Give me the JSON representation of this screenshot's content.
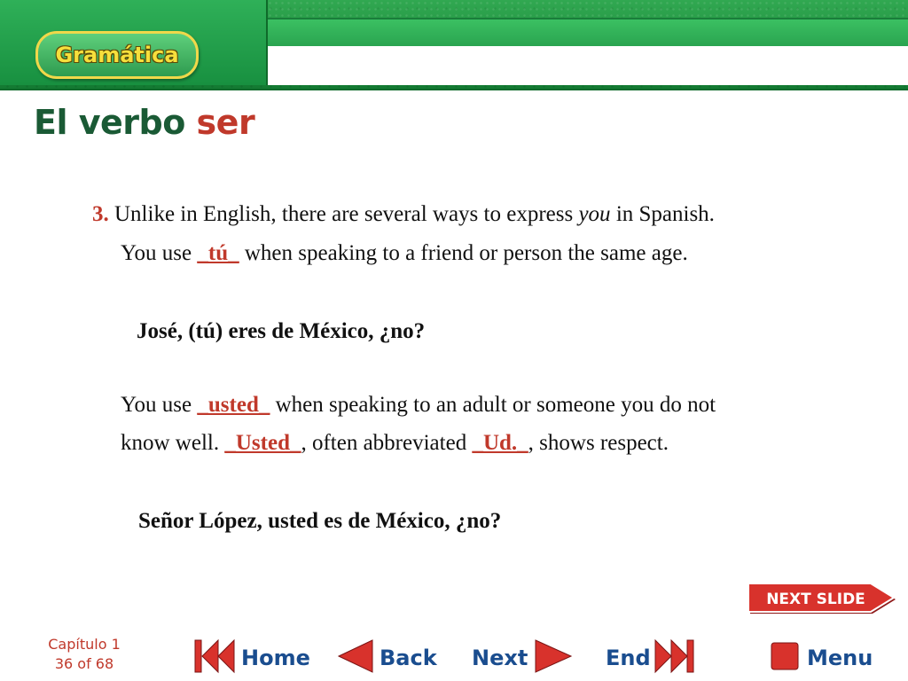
{
  "header": {
    "section_label": "Gramática"
  },
  "title": {
    "part1": "El verbo",
    "part2": "ser"
  },
  "content": {
    "point_number": "3.",
    "line1_a": " Unlike in English, there are several ways to express ",
    "line1_italic": "you",
    "line1_b": " in Spanish.",
    "line2_a": "You use ",
    "blank_tu": "_tú_",
    "line2_b": " when speaking to a friend or person the same age.",
    "example1": "José, (tú) eres de México, ¿no?",
    "line3_a": "You use ",
    "blank_usted": "_usted_",
    "line3_b": " when speaking to an adult or someone you do not",
    "line4_a": "know well. ",
    "blank_Usted": "_Usted_",
    "line4_b": ", often abbreviated ",
    "blank_Ud": "_Ud._",
    "line4_c": ", shows respect.",
    "example2": "Señor López, usted es de México, ¿no?"
  },
  "next_slide": {
    "label": "NEXT SLIDE"
  },
  "footer": {
    "chapter": "Capítulo 1",
    "page": "36 of 68",
    "home": "Home",
    "back": "Back",
    "next": "Next",
    "end": "End",
    "menu": "Menu"
  },
  "colors": {
    "accent_red": "#c0392b",
    "banner_green": "#1f8f3f",
    "title_green": "#1a5a35"
  },
  "icons": {
    "home": "double-left-arrow-icon",
    "back": "left-arrow-icon",
    "next": "right-arrow-icon",
    "end": "double-right-arrow-icon",
    "menu": "square-stop-icon"
  }
}
